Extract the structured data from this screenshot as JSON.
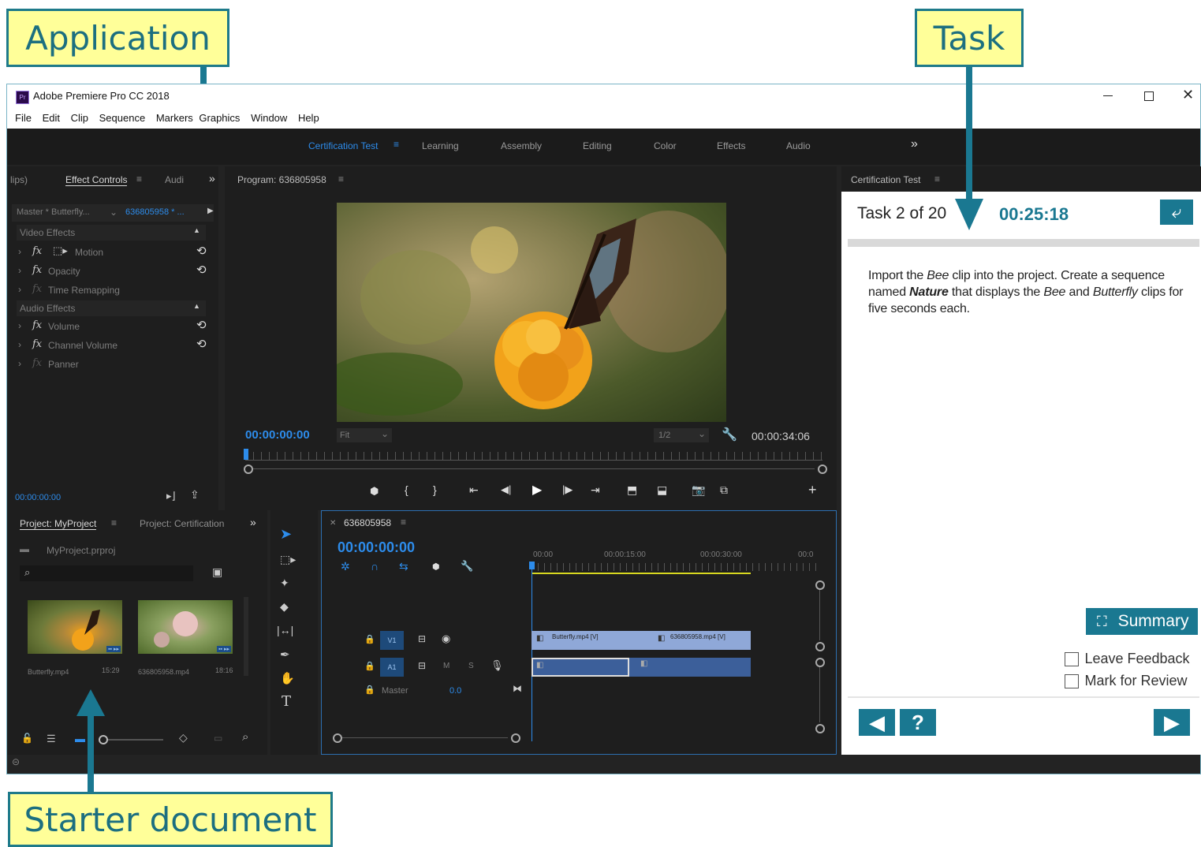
{
  "callouts": {
    "application": "Application",
    "task": "Task",
    "starter_document": "Starter document"
  },
  "window": {
    "app_icon": "Pr",
    "title": "Adobe Premiere Pro CC 2018",
    "minimize_icon": "minimize-icon",
    "maximize_icon": "maximize-icon",
    "close_icon": "close-icon"
  },
  "menu": [
    "File",
    "Edit",
    "Clip",
    "Sequence",
    "Markers",
    "Graphics",
    "Window",
    "Help"
  ],
  "workspaces": {
    "active": "Certification Test",
    "items": [
      "Learning",
      "Assembly",
      "Editing",
      "Color",
      "Effects",
      "Audio"
    ],
    "more": "»"
  },
  "effect_controls": {
    "tab_left": "lips)",
    "tab": "Effect Controls",
    "tab_right": "Audi",
    "more": "»",
    "master": "Master * Butterfly...",
    "sequence": "636805958 * ...",
    "video_effects": "Video Effects",
    "effects": [
      {
        "fx": "fx",
        "name": "Motion",
        "reset": true
      },
      {
        "fx": "fx",
        "name": "Opacity",
        "reset": true
      },
      {
        "fx": "fx",
        "name": "Time Remapping",
        "reset": false
      }
    ],
    "audio_effects": "Audio Effects",
    "audio": [
      {
        "fx": "fx",
        "name": "Volume",
        "reset": true
      },
      {
        "fx": "fx",
        "name": "Channel Volume",
        "reset": true
      },
      {
        "fx": "fx",
        "name": "Panner",
        "reset": false
      }
    ],
    "timecode": "00:00:00:00"
  },
  "program": {
    "tab": "Program: 636805958",
    "timecode": "00:00:00:00",
    "fit": "Fit",
    "resolution": "1/2",
    "duration": "00:00:34:06"
  },
  "project": {
    "tab": "Project: MyProject",
    "tab2": "Project: Certification",
    "more": "»",
    "file": "MyProject.prproj",
    "clips": [
      {
        "name": "Butterfly.mp4",
        "duration": "15:29"
      },
      {
        "name": "636805958.mp4",
        "duration": "18:16"
      }
    ]
  },
  "timeline": {
    "tab": "636805958",
    "timecode": "00:00:00:00",
    "ruler": [
      "00:00",
      "00:00:15:00",
      "00:00:30:00",
      "00:0"
    ],
    "tracks": {
      "v1": "V1",
      "a1": "A1",
      "m": "M",
      "s": "S",
      "master": "Master",
      "master_val": "0.0"
    },
    "clip1": "Butterfly.mp4 [V]",
    "clip2": "636805958.mp4 [V]"
  },
  "cert_panel": {
    "tab": "Certification Test",
    "task_label": "Task 2 of 20",
    "timer": "00:25:18",
    "instructions": {
      "p1": "Import the ",
      "bee": "Bee",
      "p2": " clip into the project. Create a sequence named ",
      "nature": "Nature",
      "p3": " that displays the ",
      "bee2": "Bee",
      "p4": " and ",
      "butterfly": "Butterfly",
      "p5": " clips for five seconds each."
    },
    "summary": "Summary",
    "leave_feedback": "Leave Feedback",
    "mark_for_review": "Mark for Review",
    "progress": 0.1
  }
}
